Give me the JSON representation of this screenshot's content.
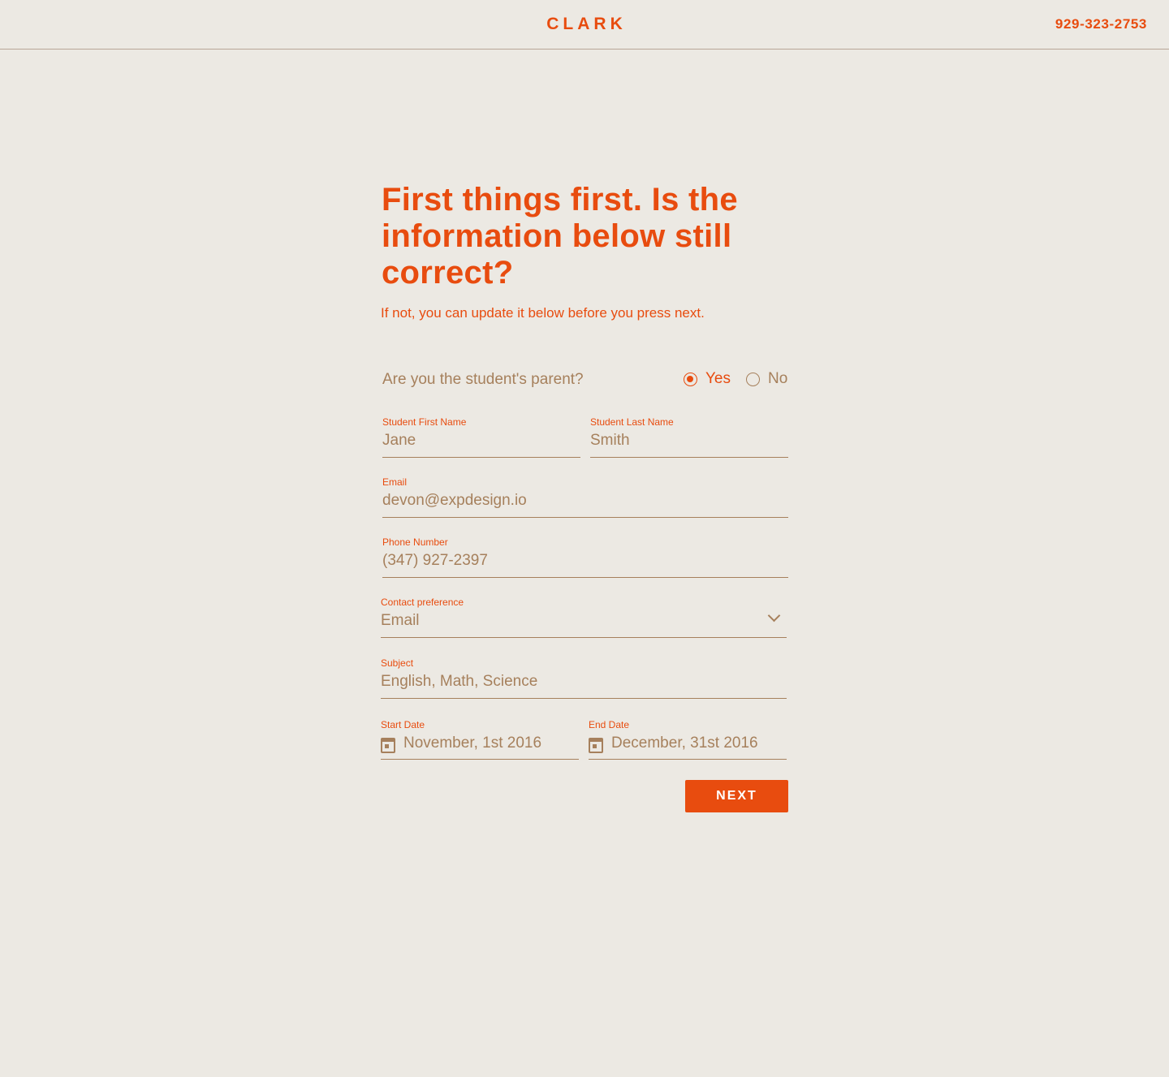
{
  "header": {
    "logo": "CLARK",
    "phone": "929-323-2753"
  },
  "headline": "First things first. Is the information below still correct?",
  "subhead": "If not, you can update it below before you press next.",
  "parent_question": {
    "label": "Are you the student's parent?",
    "options": [
      {
        "label": "Yes",
        "selected": true
      },
      {
        "label": "No",
        "selected": false
      }
    ]
  },
  "fields": {
    "first_name": {
      "label": "Student First Name",
      "value": "Jane"
    },
    "last_name": {
      "label": "Student Last Name",
      "value": "Smith"
    },
    "email": {
      "label": "Email",
      "value": "devon@expdesign.io"
    },
    "phone": {
      "label": "Phone Number",
      "value": "(347) 927-2397"
    },
    "contact_pref": {
      "label": "Contact preference",
      "value": "Email"
    },
    "subject": {
      "label": "Subject",
      "value": "English, Math, Science"
    },
    "start_date": {
      "label": "Start Date",
      "value": "November, 1st 2016"
    },
    "end_date": {
      "label": "End Date",
      "value": "December, 31st 2016"
    }
  },
  "next_label": "NEXT",
  "colors": {
    "accent": "#e84c0f",
    "muted": "#a6805c",
    "background": "#ece9e3"
  },
  "icons": [
    "calendar-icon",
    "chevron-down-icon",
    "radio-checked-icon",
    "radio-unchecked-icon"
  ]
}
